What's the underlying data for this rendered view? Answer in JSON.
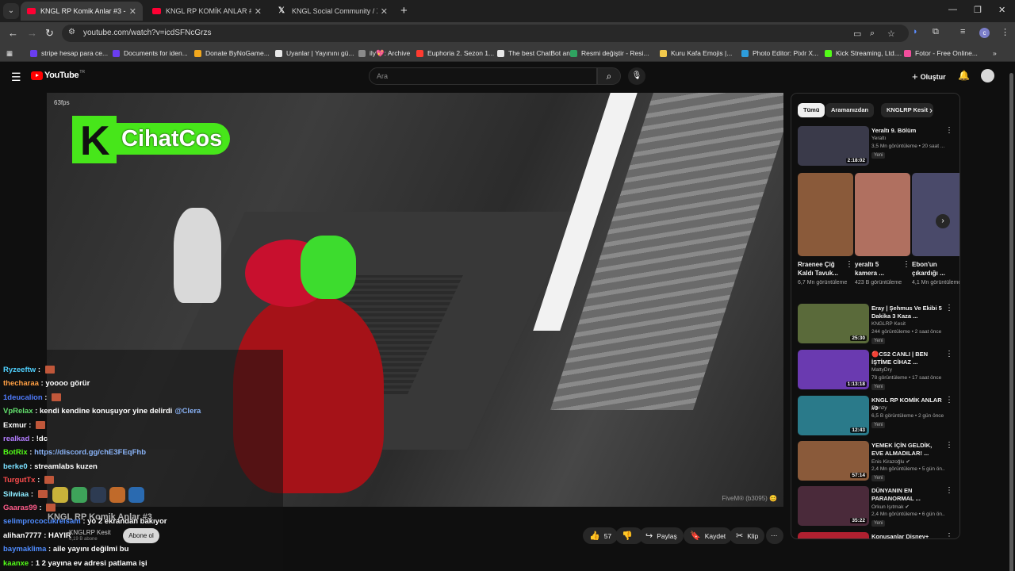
{
  "browser": {
    "tabs": [
      {
        "title": "KNGL RP Komik Anlar #3 - YouTube",
        "active": true,
        "icon": "youtube-icon"
      },
      {
        "title": "KNGL RP KOMİK ANLAR #12 - YouTube",
        "active": false,
        "icon": "youtube-icon"
      },
      {
        "title": "KNGL Social Community / X",
        "active": false,
        "icon": "x-icon"
      }
    ],
    "new_tab": "+",
    "url": "youtube.com/watch?v=icdSFNcGrzs",
    "bookmarks": [
      {
        "label": "stripe hesap para ce...",
        "color": "#6a3df0"
      },
      {
        "label": "Documents for iden...",
        "color": "#6a3df0"
      },
      {
        "label": "Donate ByNoGame...",
        "color": "#f2a81d"
      },
      {
        "label": "Uyanlar | Yayınını gü...",
        "color": "#e8e8e8"
      },
      {
        "label": "ily💖: Archive",
        "color": "#8a8a8a"
      },
      {
        "label": "Euphoria 2. Sezon 1...",
        "color": "#ff3b30"
      },
      {
        "label": "The best ChatBot an...",
        "color": "#e8e8e8"
      },
      {
        "label": "Resmi değiştir - Resi...",
        "color": "#2fa360"
      },
      {
        "label": "Kuru Kafa Emojis |...",
        "color": "#f2c94c"
      },
      {
        "label": "Photo Editor: Pixlr X...",
        "color": "#2d9cdb"
      },
      {
        "label": "Kick Streaming, Ltd....",
        "color": "#53fc18"
      },
      {
        "label": "Fotor - Free Online...",
        "color": "#f24e9c"
      }
    ]
  },
  "youtube": {
    "logo": "YouTube",
    "logo_region": "TR",
    "search_placeholder": "Ara",
    "create_label": "Oluştur"
  },
  "video": {
    "fps": "63fps",
    "overlay_brand": "CihatCos",
    "watermark": "FiveM® (b3095) 😊",
    "title": "KNGL RP Komik Anlar #3",
    "channel": "KNGLRP Kesit",
    "subscribers": "6,19 B abone",
    "subscribe_label": "Abone ol",
    "likes": "57",
    "share_label": "Paylaş",
    "save_label": "Kaydet",
    "clip_label": "Klip"
  },
  "chat": [
    {
      "user": "Ryzeeftw",
      "color": "#4fd1ff",
      "text": "",
      "emote": true
    },
    {
      "user": "thecharaa",
      "color": "#ff9f43",
      "text": "yoooo görür",
      "emote": false
    },
    {
      "user": "1deucalion",
      "color": "#4f7cff",
      "text": "",
      "emote": true
    },
    {
      "user": "VpRelax",
      "color": "#63e06e",
      "text": "kendi kendine konuşuyor yine delirdi",
      "mention": "@Clera",
      "emote": false
    },
    {
      "user": "Exmur",
      "color": "#ffffff",
      "text": "",
      "emote": true
    },
    {
      "user": "realkad",
      "color": "#b37dff",
      "text": "!dc",
      "emote": false
    },
    {
      "user": "BotRix",
      "color": "#53fc18",
      "text": "",
      "link": "https://discord.gg/chE3FEqFhb",
      "emote": false
    },
    {
      "user": "berke0",
      "color": "#7ae0ff",
      "text": "streamlabs kuzen",
      "emote": false
    },
    {
      "user": "TurgutTx",
      "color": "#ff4d4d",
      "text": "",
      "emote": true
    },
    {
      "user": "Silwiaa",
      "color": "#8be9fd",
      "text": "",
      "emote": true
    },
    {
      "user": "Gaaras99",
      "color": "#ff5c8a",
      "text": "",
      "emote": true
    },
    {
      "user": "selimprococukreisam",
      "color": "#4f8cff",
      "text": "yo 2 ekrandan bakıyor",
      "emote": false
    },
    {
      "user": "alihan7777",
      "color": "#ffffff",
      "text": "HAYIR",
      "emote": false
    },
    {
      "user": "baymaklima",
      "color": "#4f8cff",
      "text": "aile yayını değilmi bu",
      "emote": false
    },
    {
      "user": "kaanxe",
      "color": "#53fc18",
      "text": "1 2 yayına ev adresi patlama işi",
      "emote": false
    }
  ],
  "chips": [
    "Tümü",
    "Aramanızdan",
    "KNGLRP Kesit"
  ],
  "shorts": [
    {
      "title": "Rraenee Çiğ Kaldı Tavuk...",
      "views": "6,7 Mn görüntüleme",
      "color": "#8a5a3a"
    },
    {
      "title": "yeraltı 5 kamera ...",
      "views": "423 B görüntüleme",
      "color": "#b07060"
    },
    {
      "title": "Ebon'un çıkardığı ...",
      "views": "4,1 Mn görüntüleme",
      "color": "#4a4a6a"
    }
  ],
  "recs": [
    {
      "title": "Yeraltı 9. Bölüm",
      "channel": "Yeraltı",
      "meta": "3,5 Mn görüntüleme • 20 saat ...",
      "duration": "2:18:02",
      "isnew": "Yeni",
      "color": "#3a3a4a"
    },
    {
      "title": "Eray | Şehmus Ve Ekibi 5 Dakika 3 Kaza ...",
      "channel": "KNGLRP Kesit",
      "meta": "244 görüntüleme • 2 saat önce",
      "duration": "25:30",
      "isnew": "Yeni",
      "color": "#5a6a3a"
    },
    {
      "title": "🔴CS2 CANLI | BEN İŞTİME CİHAZ ...",
      "channel": "MattyDry",
      "meta": "78 görüntüleme • 17 saat önce",
      "duration": "1:13:18",
      "isnew": "Yeni",
      "color": "#6a3ab0"
    },
    {
      "title": "KNGL RP KOMİK ANLAR #9",
      "channel": "Elenzy",
      "meta": "6,5 B görüntüleme • 2 gün önce",
      "duration": "12:43",
      "isnew": "Yeni",
      "color": "#2a7a8a"
    },
    {
      "title": "YEMEK İÇİN GELDİK, EVE ALMADILAR! ...",
      "channel": "Enis Kirazoğlu ✔",
      "meta": "2,4 Mn görüntüleme • 5 gün ön...",
      "duration": "57:14",
      "isnew": "Yeni",
      "color": "#8a5a3a"
    },
    {
      "title": "DÜNYANIN EN PARANORMAL ...",
      "channel": "Orkun Işıtmak ✔",
      "meta": "2,4 Mn görüntüleme • 6 gün ön...",
      "duration": "35:22",
      "isnew": "Yeni",
      "color": "#4a2a3a"
    },
    {
      "title": "Konuşanlar Disney+",
      "channel": "",
      "meta": "",
      "duration": "",
      "isnew": "",
      "color": "#b02030"
    }
  ]
}
